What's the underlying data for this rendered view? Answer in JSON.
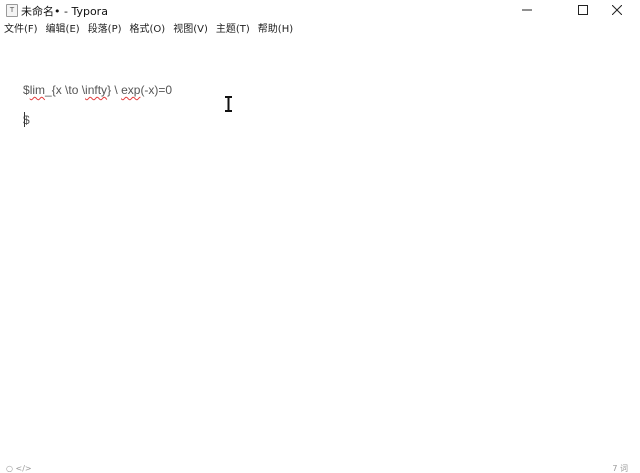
{
  "window": {
    "title": "未命名• - Typora",
    "app_icon_glyph": "T",
    "controls": {
      "minimize": "minimize-icon",
      "maximize": "maximize-icon",
      "close": "close-icon"
    }
  },
  "menubar": {
    "items": [
      {
        "label": "文件(F)"
      },
      {
        "label": "编辑(E)"
      },
      {
        "label": "段落(P)"
      },
      {
        "label": "格式(O)"
      },
      {
        "label": "视图(V)"
      },
      {
        "label": "主题(T)"
      },
      {
        "label": "帮助(H)"
      }
    ]
  },
  "editor": {
    "lines": {
      "line1": {
        "prefix": "$",
        "word1": "lim",
        "part2": "_{x \\to \\",
        "word2": "infty",
        "part3": "} \\ ",
        "word3": "exp",
        "part4": "(-x)=0"
      },
      "line2": "$"
    },
    "spellcheck_color": "#e23b3b"
  },
  "statusbar": {
    "left": "○ </>",
    "right": "7 词"
  }
}
